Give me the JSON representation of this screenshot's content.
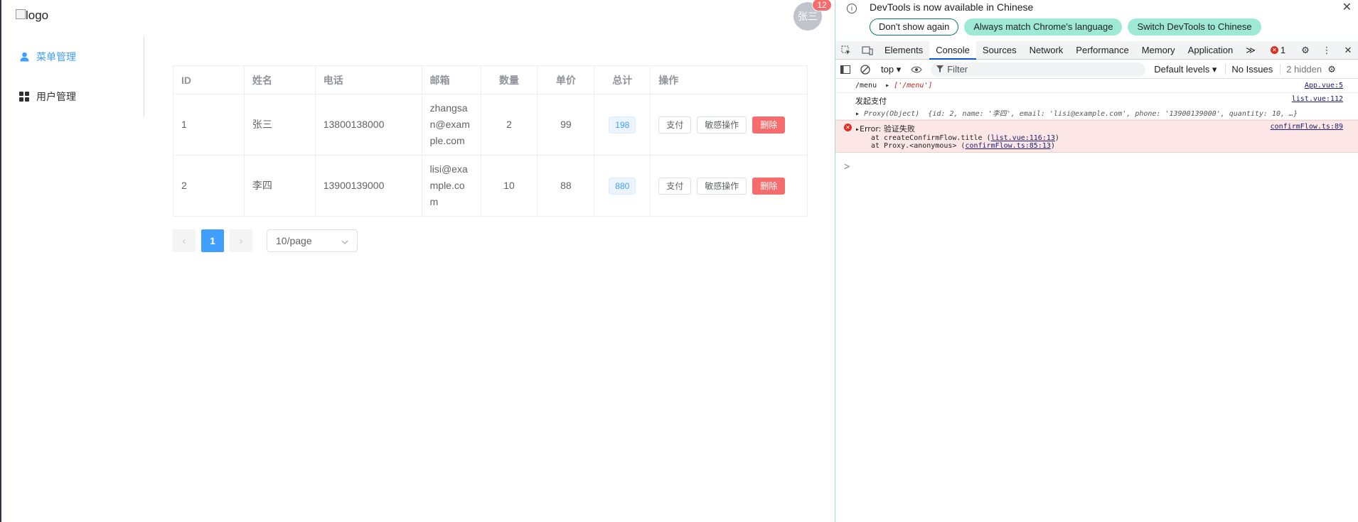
{
  "app": {
    "logo_alt": "logo",
    "avatar_text": "张三",
    "badge_count": "12",
    "sidebar": [
      {
        "label": "菜单管理",
        "active": true,
        "icon": "user-icon"
      },
      {
        "label": "用户管理",
        "active": false,
        "icon": "grid-icon"
      }
    ],
    "table": {
      "headers": [
        "ID",
        "姓名",
        "电话",
        "邮箱",
        "数量",
        "单价",
        "总计",
        "操作"
      ],
      "rows": [
        {
          "id": "1",
          "name": "张三",
          "phone": "13800138000",
          "email": "zhangsan@example.com",
          "qty": "2",
          "price": "99",
          "total": "198"
        },
        {
          "id": "2",
          "name": "李四",
          "phone": "13900139000",
          "email": "lisi@example.com",
          "qty": "10",
          "price": "88",
          "total": "880"
        }
      ],
      "actions": {
        "pay": "支付",
        "sensitive": "敏感操作",
        "delete": "删除"
      }
    },
    "pager": {
      "prev": "‹",
      "current": "1",
      "next": "›",
      "page_size": "10/page"
    }
  },
  "devtools": {
    "notice": {
      "message": "DevTools is now available in Chinese",
      "btn_dont_show": "Don't show again",
      "btn_always_match": "Always match Chrome's language",
      "btn_switch": "Switch DevTools to Chinese"
    },
    "tabs": [
      "Elements",
      "Console",
      "Sources",
      "Network",
      "Performance",
      "Memory",
      "Application"
    ],
    "active_tab": "Console",
    "more": "≫",
    "error_count": "1",
    "toolbar": {
      "context": "top",
      "filter_placeholder": "Filter",
      "levels": "Default levels",
      "issues": "No Issues",
      "hidden": "2 hidden"
    },
    "console": {
      "line1": {
        "text": "/menu",
        "value": "['/menu']",
        "src": "App.vue:5"
      },
      "line2": {
        "text": "发起支付",
        "src": "list.vue:112"
      },
      "line3_obj": "Proxy(Object)",
      "line3_body": "{id: 2, name: '李四', email: 'lisi@example.com', phone: '13900139000', quantity: 10, …}",
      "error": {
        "label": "Error: 验证失败",
        "src": "confirmFlow.ts:89",
        "frame1_text": "at createConfirmFlow.title (",
        "frame1_link": "list.vue:116:13",
        "frame2_text": "at Proxy.<anonymous> (",
        "frame2_link": "confirmFlow.ts:85:13"
      },
      "prompt": ">"
    }
  }
}
